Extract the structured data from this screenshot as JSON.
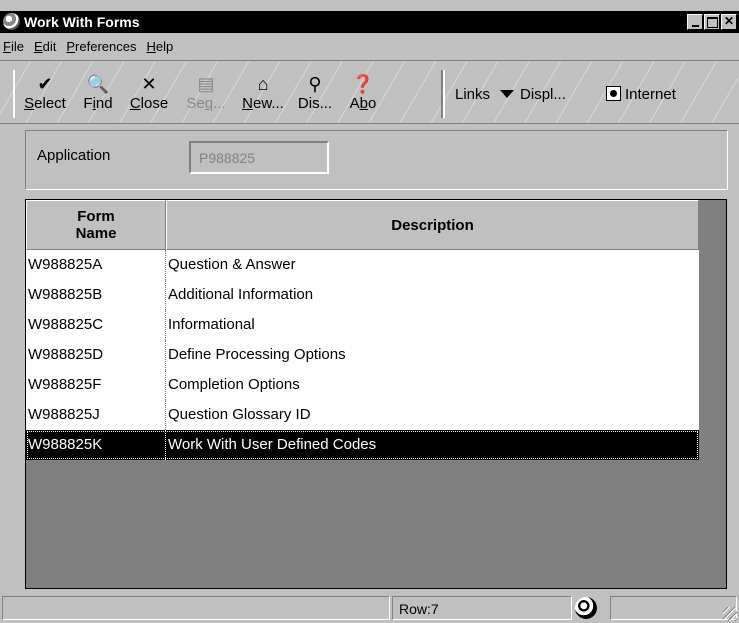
{
  "window": {
    "title": "Work With Forms"
  },
  "menu": [
    {
      "label": "File",
      "u": "F",
      "rest": "ile"
    },
    {
      "label": "Edit",
      "u": "E",
      "rest": "dit"
    },
    {
      "label": "Preferences",
      "u": "P",
      "rest": "references"
    },
    {
      "label": "Help",
      "u": "H",
      "rest": "elp"
    }
  ],
  "toolbar": {
    "buttons": [
      {
        "pre": "",
        "u": "S",
        "post": "elect",
        "icon": "checkmark-icon",
        "glyph": "✔",
        "enabled": true
      },
      {
        "pre": "F",
        "u": "i",
        "post": "nd",
        "icon": "find-icon",
        "glyph": "🔍",
        "enabled": true
      },
      {
        "pre": "",
        "u": "C",
        "post": "lose",
        "icon": "close-icon",
        "glyph": "✕",
        "enabled": true
      },
      {
        "pre": "Se",
        "u": "q",
        "post": "...",
        "icon": "sequence-icon",
        "glyph": "▤",
        "enabled": false
      },
      {
        "pre": "",
        "u": "N",
        "post": "ew...",
        "icon": "new-icon",
        "glyph": "⌂",
        "enabled": true
      },
      {
        "pre": "Dis...",
        "u": "",
        "post": "",
        "icon": "display-icon",
        "glyph": "⚲",
        "enabled": true
      },
      {
        "pre": "A",
        "u": "b",
        "post": "o",
        "icon": "about-icon",
        "glyph": "❓",
        "enabled": true
      }
    ],
    "links_label": "Links",
    "display_label": "Displ...",
    "internet_label": "Internet"
  },
  "header": {
    "application_label": "Application",
    "application_value": "P988825"
  },
  "grid": {
    "columns": [
      "Form Name",
      "Description"
    ],
    "rows": [
      {
        "form": "W988825A",
        "desc": "Question & Answer"
      },
      {
        "form": "W988825B",
        "desc": "Additional Information"
      },
      {
        "form": "W988825C",
        "desc": "Informational"
      },
      {
        "form": "W988825D",
        "desc": "Define Processing Options"
      },
      {
        "form": "W988825F",
        "desc": "Completion Options"
      },
      {
        "form": "W988825J",
        "desc": "Question Glossary ID"
      },
      {
        "form": "W988825K",
        "desc": "Work With User Defined Codes"
      }
    ],
    "selected_index": 6
  },
  "status": {
    "row_text": "Row:7"
  }
}
